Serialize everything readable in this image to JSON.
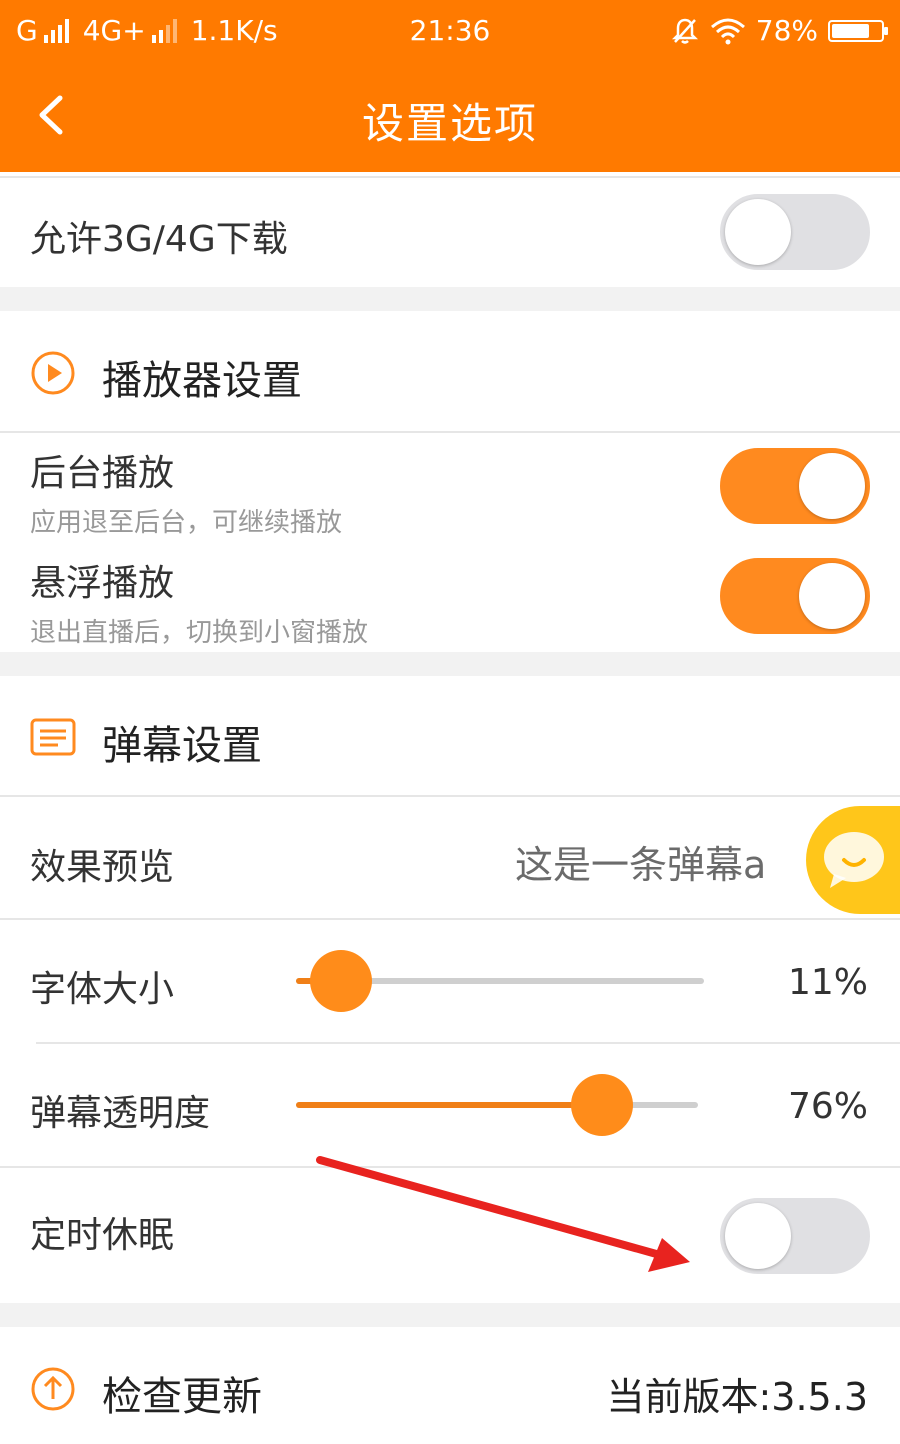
{
  "status_bar": {
    "carrier1": "G",
    "carrier2": "4G+",
    "speed": "1.1K/s",
    "time": "21:36",
    "battery": "78%",
    "battery_level": 0.78
  },
  "header": {
    "title": "设置选项",
    "back_icon": "chevron-left-icon"
  },
  "download": {
    "label": "允许3G/4G下载",
    "enabled": false
  },
  "player_section": {
    "title": "播放器设置",
    "icon": "play-circle-icon",
    "background_play": {
      "label": "后台播放",
      "description": "应用退至后台，可继续播放",
      "enabled": true
    },
    "floating_play": {
      "label": "悬浮播放",
      "description": "退出直播后，切换到小窗播放",
      "enabled": true
    }
  },
  "danmaku_section": {
    "title": "弹幕设置",
    "icon": "danmaku-list-icon",
    "preview": {
      "label": "效果预览",
      "value": "这是一条弹幕a"
    },
    "font_size": {
      "label": "字体大小",
      "value": "11%",
      "level": 0.11
    },
    "opacity": {
      "label": "弹幕透明度",
      "value": "76%",
      "level": 0.76
    },
    "sleep_timer": {
      "label": "定时休眠",
      "enabled": false
    }
  },
  "update_section": {
    "title": "检查更新",
    "icon": "arrow-up-circle-icon",
    "version": "当前版本:3.5.3"
  },
  "colors": {
    "accent": "#ff7a00",
    "toggle_on": "#ff8a1f",
    "chat_bubble": "#ffc61a",
    "annotation_arrow": "#e8231f"
  }
}
